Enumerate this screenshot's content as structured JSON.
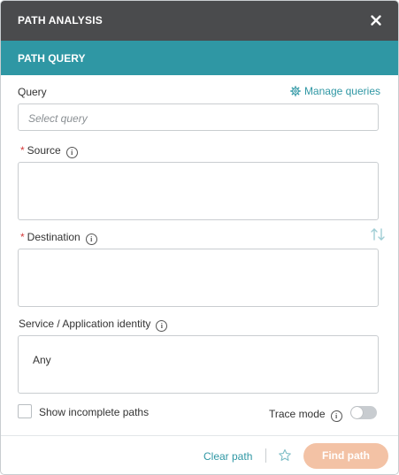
{
  "header": {
    "title": "PATH ANALYSIS",
    "close_icon": "close-icon"
  },
  "section": {
    "title": "PATH QUERY"
  },
  "query": {
    "label": "Query",
    "placeholder": "Select query",
    "manage_label": "Manage queries"
  },
  "source": {
    "required_mark": "*",
    "label": "Source",
    "value": ""
  },
  "destination": {
    "required_mark": "*",
    "label": "Destination",
    "value": ""
  },
  "service": {
    "label": "Service / Application identity",
    "value": "Any"
  },
  "options": {
    "show_incomplete_label": "Show incomplete paths",
    "show_incomplete_checked": false,
    "trace_mode_label": "Trace mode",
    "trace_mode_on": false
  },
  "footer": {
    "clear_label": "Clear path",
    "find_label": "Find path"
  },
  "colors": {
    "header_bg": "#4a4b4d",
    "section_bg": "#2f97a4",
    "link": "#2f97a4",
    "required": "#d43b3b",
    "primary_disabled": "#f3c2a5"
  }
}
